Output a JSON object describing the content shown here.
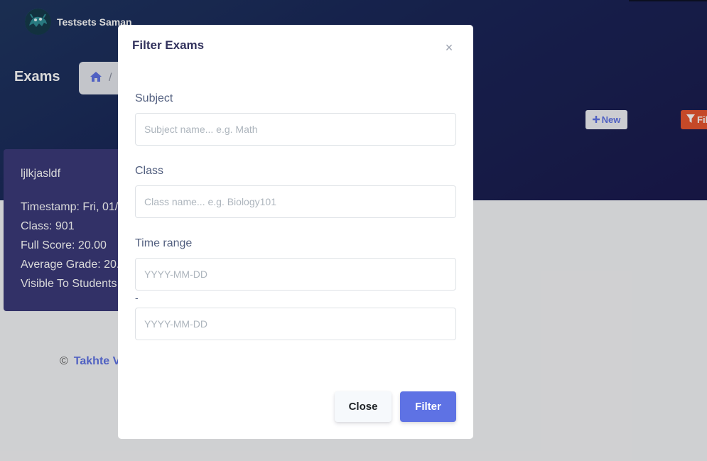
{
  "brand": {
    "name": "Testsets Saman",
    "avatar_icon": "monster-avatar-icon"
  },
  "page": {
    "title": "Exams",
    "breadcrumb": {
      "home_icon": "home-icon",
      "separator": "/"
    },
    "actions": {
      "new_label": "New",
      "new_icon": "plus-icon",
      "filter_label": "Filter",
      "filter_icon": "filter-icon"
    }
  },
  "exam_card": {
    "title": "ljlkjasldf",
    "lines": [
      "Timestamp: Fri, 01/",
      "Class: 901",
      "Full Score: 20.00",
      "Average Grade: 20.",
      "Visible To Students"
    ]
  },
  "footer": {
    "copyright": "©",
    "link_text": "Takhte V"
  },
  "modal": {
    "title": "Filter Exams",
    "close_icon": "close-icon",
    "subject": {
      "label": "Subject",
      "placeholder": "Subject name... e.g. Math",
      "value": ""
    },
    "class": {
      "label": "Class",
      "placeholder": "Class name... e.g. Biology101",
      "value": ""
    },
    "time_range": {
      "label": "Time range",
      "start_placeholder": "YYYY-MM-DD",
      "separator": "-",
      "end_placeholder": "YYYY-MM-DD"
    },
    "close_button": "Close",
    "submit_button": "Filter"
  },
  "colors": {
    "primary": "#5e72e4",
    "filter_button": "#e8562f",
    "header_dark": "#1a2658",
    "card": "#3b3a7a"
  }
}
